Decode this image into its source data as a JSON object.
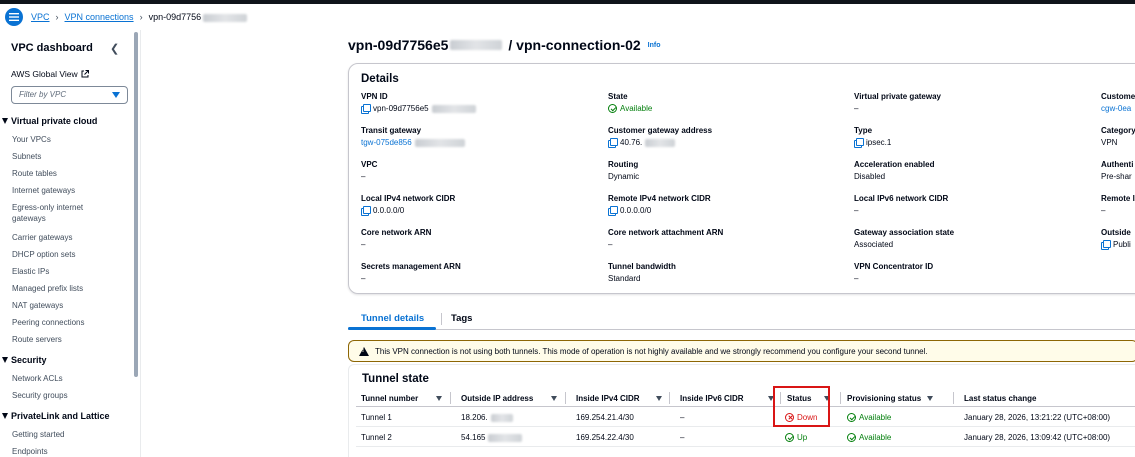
{
  "breadcrumb": {
    "items": [
      "VPC",
      "VPN connections",
      "vpn-09d7756"
    ]
  },
  "sidebar": {
    "title": "VPC dashboard",
    "global_view": "AWS Global View",
    "filter_placeholder": "Filter by VPC",
    "sections": [
      {
        "title": "Virtual private cloud",
        "items": [
          "Your VPCs",
          "Subnets",
          "Route tables",
          "Internet gateways",
          "Egress-only internet gateways",
          "Carrier gateways",
          "DHCP option sets",
          "Elastic IPs",
          "Managed prefix lists",
          "NAT gateways",
          "Peering connections",
          "Route servers"
        ]
      },
      {
        "title": "Security",
        "items": [
          "Network ACLs",
          "Security groups"
        ]
      },
      {
        "title": "PrivateLink and Lattice",
        "items": [
          "Getting started",
          "Endpoints"
        ]
      }
    ]
  },
  "page": {
    "title_left": "vpn-09d7756e5",
    "title_right": "/ vpn-connection-02",
    "info": "Info"
  },
  "details": {
    "heading": "Details",
    "col1": [
      {
        "label": "VPN ID",
        "value": "vpn-09d7756e5"
      },
      {
        "label": "Transit gateway",
        "value": "tgw-075de856"
      },
      {
        "label": "VPC",
        "value": "–"
      },
      {
        "label": "Local IPv4 network CIDR",
        "value": "0.0.0.0/0"
      },
      {
        "label": "Core network ARN",
        "value": "–"
      },
      {
        "label": "Secrets management ARN",
        "value": "–"
      }
    ],
    "col2": [
      {
        "label": "State",
        "value": "Available"
      },
      {
        "label": "Customer gateway address",
        "value": "40.76."
      },
      {
        "label": "Routing",
        "value": "Dynamic"
      },
      {
        "label": "Remote IPv4 network CIDR",
        "value": "0.0.0.0/0"
      },
      {
        "label": "Core network attachment ARN",
        "value": "–"
      },
      {
        "label": "Tunnel bandwidth",
        "value": "Standard"
      }
    ],
    "col3": [
      {
        "label": "Virtual private gateway",
        "value": "–"
      },
      {
        "label": "Type",
        "value": "ipsec.1"
      },
      {
        "label": "Acceleration enabled",
        "value": "Disabled"
      },
      {
        "label": "Local IPv6 network CIDR",
        "value": "–"
      },
      {
        "label": "Gateway association state",
        "value": "Associated"
      },
      {
        "label": "VPN Concentrator ID",
        "value": "–"
      }
    ],
    "col4": [
      {
        "label": "Custome",
        "value": "cgw-0ea"
      },
      {
        "label": "Category",
        "value": "VPN"
      },
      {
        "label": "Authenti",
        "value": "Pre-shar"
      },
      {
        "label": "Remote I",
        "value": "–"
      },
      {
        "label": "Outside",
        "value": "Publi"
      }
    ]
  },
  "tabs": [
    "Tunnel details",
    "Tags"
  ],
  "warning": "This VPN connection is not using both tunnels. This mode of operation is not highly available and we strongly recommend you configure your second tunnel.",
  "tunnel_state": {
    "title": "Tunnel state",
    "headers": [
      "Tunnel number",
      "Outside IP address",
      "Inside IPv4 CIDR",
      "Inside IPv6 CIDR",
      "Status",
      "Provisioning status",
      "Last status change"
    ],
    "rows": [
      {
        "number": "Tunnel 1",
        "outside_ip": "18.206.",
        "ipv4": "169.254.21.4/30",
        "ipv6": "–",
        "status": "Down",
        "provisioning": "Available",
        "last_change": "January 28, 2026, 13:21:22 (UTC+08:00)"
      },
      {
        "number": "Tunnel 2",
        "outside_ip": "54.165",
        "ipv4": "169.254.22.4/30",
        "ipv6": "–",
        "status": "Up",
        "provisioning": "Available",
        "last_change": "January 28, 2026, 13:09:42 (UTC+08:00)"
      }
    ]
  },
  "colors": {
    "link": "#0972d3",
    "success": "#037f0c",
    "error": "#d91515",
    "warning_bg": "#fffce9"
  }
}
